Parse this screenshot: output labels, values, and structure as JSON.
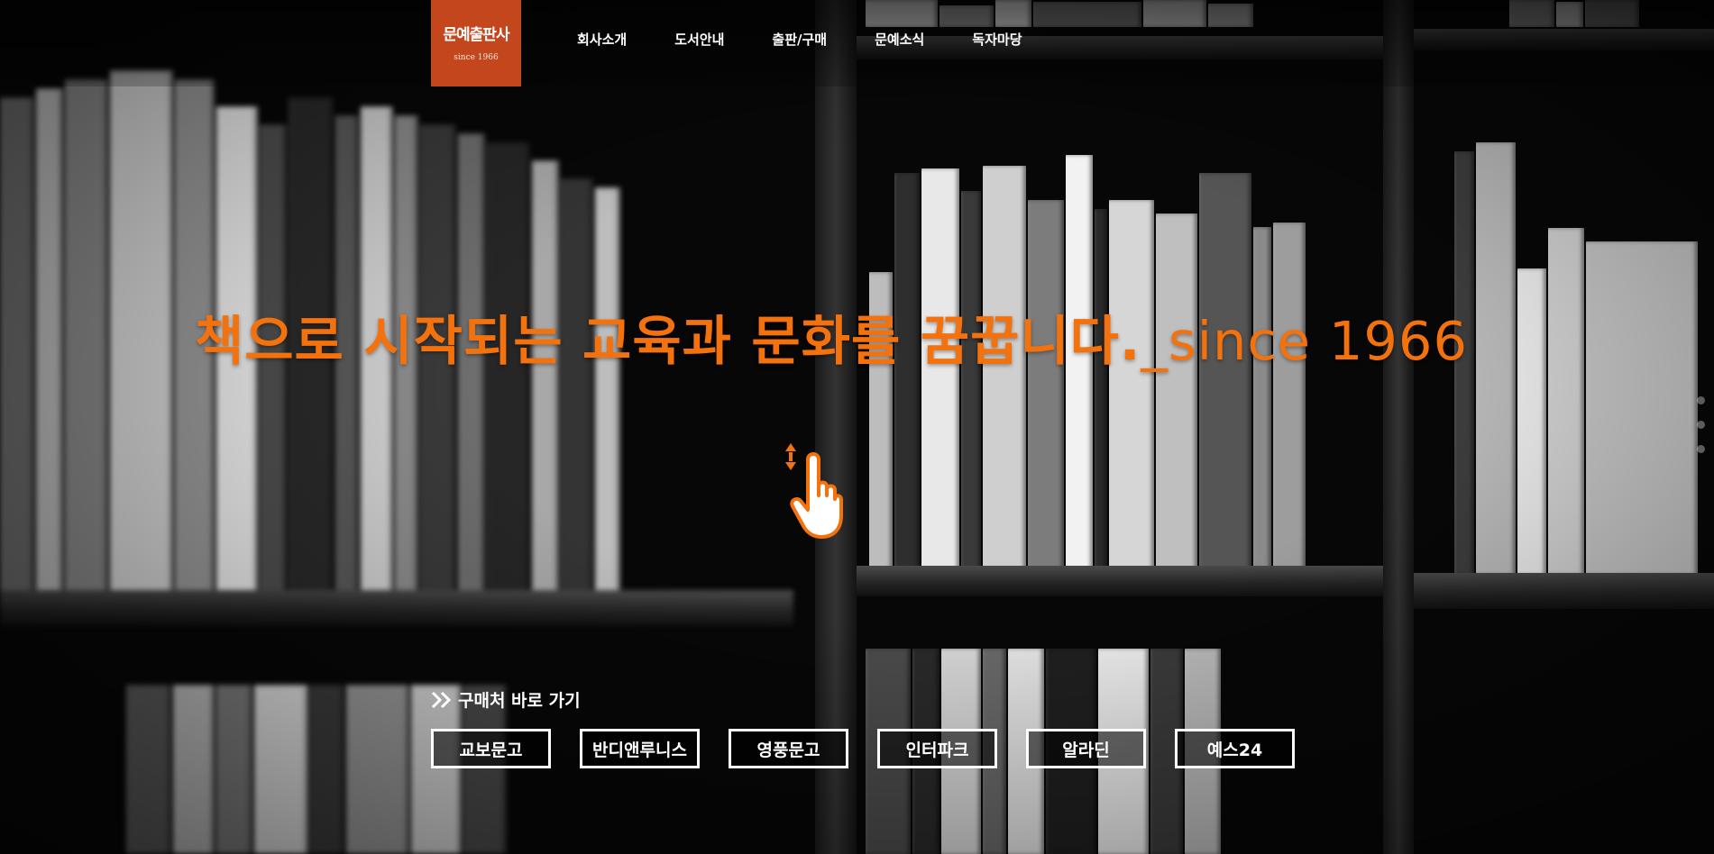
{
  "header": {
    "logo": {
      "name": "문예출판사",
      "since": "since 1966",
      "color": "#c4461d"
    },
    "nav": [
      {
        "label": "회사소개"
      },
      {
        "label": "도서안내"
      },
      {
        "label": "출판/구매"
      },
      {
        "label": "문예소식"
      },
      {
        "label": "독자마당"
      }
    ]
  },
  "hero": {
    "headline": "책으로 시작되는 교육과 문화를 꿈꿉니다.",
    "since": "_since 1966",
    "color": "#f3720e"
  },
  "scroll_hint": {
    "icon": "scroll-hand-icon"
  },
  "buy": {
    "title": "구매처 바로 가기",
    "icon": "double-chevron-right-icon",
    "stores": [
      {
        "label": "교보문고"
      },
      {
        "label": "반디앤루니스"
      },
      {
        "label": "영풍문고"
      },
      {
        "label": "인터파크"
      },
      {
        "label": "알라딘"
      },
      {
        "label": "예스24"
      }
    ]
  }
}
